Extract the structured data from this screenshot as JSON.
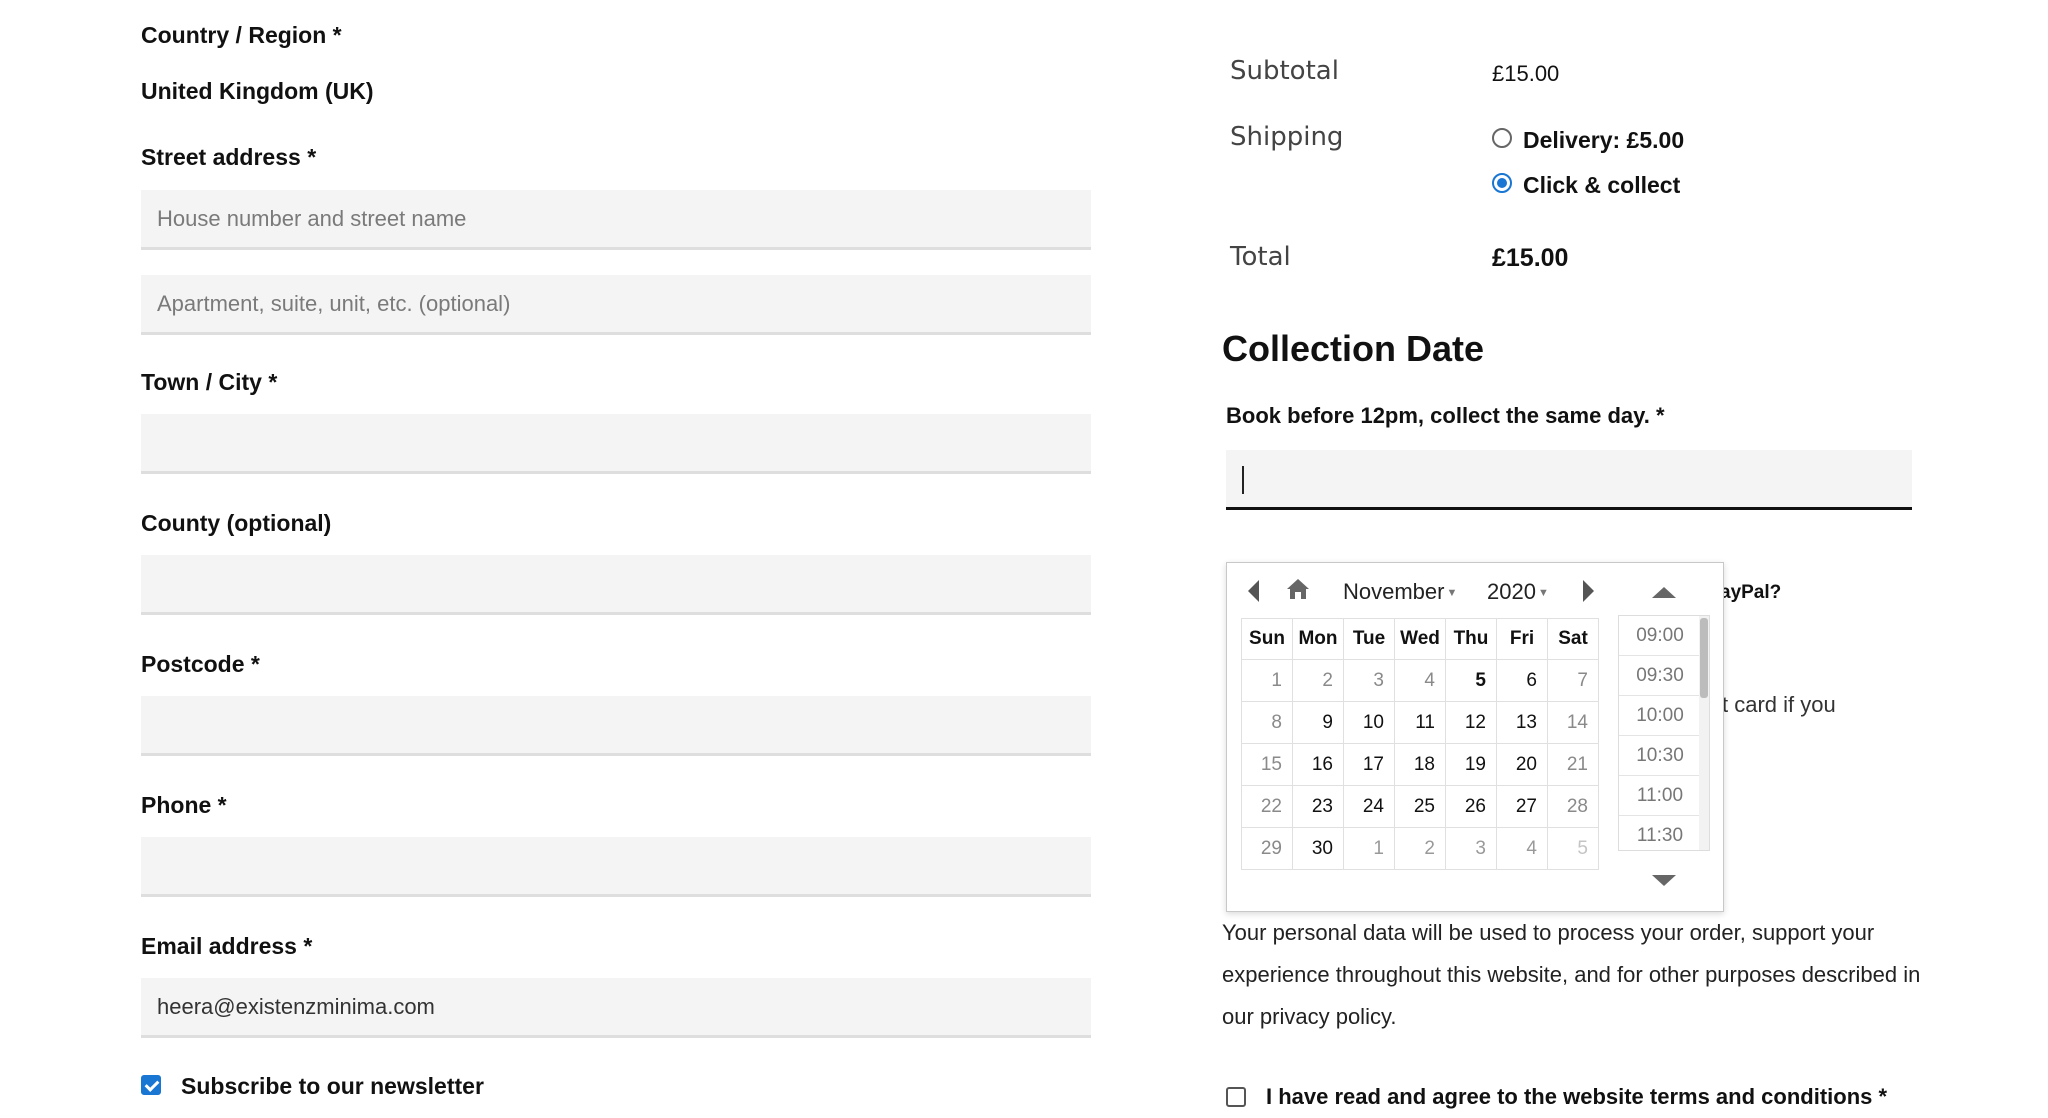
{
  "billing": {
    "country_label": "Country / Region *",
    "country_value": "United Kingdom (UK)",
    "street_label": "Street address *",
    "street1_placeholder": "House number and street name",
    "street2_placeholder": "Apartment, suite, unit, etc. (optional)",
    "city_label": "Town / City *",
    "county_label": "County (optional)",
    "postcode_label": "Postcode *",
    "phone_label": "Phone *",
    "email_label": "Email address *",
    "email_value": "heera@existenzminima.com",
    "newsletter_label": "Subscribe to our newsletter"
  },
  "order": {
    "subtotal_label": "Subtotal",
    "subtotal_value": "£15.00",
    "shipping_label": "Shipping",
    "shipping_options": [
      "Delivery: £5.00",
      "Click & collect"
    ],
    "selected_shipping": "Click & collect",
    "total_label": "Total",
    "total_value": "£15.00"
  },
  "collection": {
    "title": "Collection Date",
    "field_label": "Book before 12pm, collect the same day. *",
    "input_value": ""
  },
  "picker": {
    "month": "November",
    "year": "2020",
    "weekdays": [
      "Sun",
      "Mon",
      "Tue",
      "Wed",
      "Thu",
      "Fri",
      "Sat"
    ],
    "weeks": [
      [
        "1",
        "2",
        "3",
        "4",
        "5",
        "6",
        "7"
      ],
      [
        "8",
        "9",
        "10",
        "11",
        "12",
        "13",
        "14"
      ],
      [
        "15",
        "16",
        "17",
        "18",
        "19",
        "20",
        "21"
      ],
      [
        "22",
        "23",
        "24",
        "25",
        "26",
        "27",
        "28"
      ],
      [
        "29",
        "30",
        "1",
        "2",
        "3",
        "4",
        "5"
      ]
    ],
    "times": [
      "09:00",
      "09:30",
      "10:00",
      "10:30",
      "11:00",
      "11:30"
    ]
  },
  "partially_hidden": {
    "payment_question": "ayPal?",
    "payment_note": "t card if you"
  },
  "privacy_text": "Your personal data will be used to process your order, support your experience throughout this website, and for other purposes described in our privacy policy.",
  "terms_label": "I have read and agree to the website terms and conditions *",
  "colors": {
    "accent": "#1976d2",
    "field_bg": "#f4f4f4"
  }
}
